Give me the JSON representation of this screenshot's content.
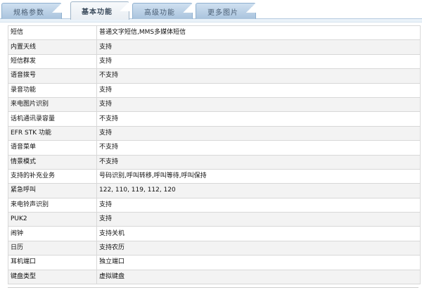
{
  "tabs": [
    {
      "label": "规格参数",
      "active": false
    },
    {
      "label": "基本功能",
      "active": true
    },
    {
      "label": "高级功能",
      "active": false
    },
    {
      "label": "更多图片",
      "active": false
    }
  ],
  "specs": [
    {
      "key": "短信",
      "value": "普通文字短信,MMS多媒体短信"
    },
    {
      "key": "内置天线",
      "value": "支持"
    },
    {
      "key": "短信群发",
      "value": "支持"
    },
    {
      "key": "语音拨号",
      "value": "不支持"
    },
    {
      "key": "录音功能",
      "value": "支持"
    },
    {
      "key": "来电图片识别",
      "value": "支持"
    },
    {
      "key": "话机通讯录容量",
      "value": "不支持"
    },
    {
      "key": "EFR STK 功能",
      "value": "支持"
    },
    {
      "key": "语音菜单",
      "value": "不支持"
    },
    {
      "key": "情景模式",
      "value": "不支持"
    },
    {
      "key": "支持的补充业务",
      "value": "号码识别,呼叫转移,呼叫等待,呼叫保持"
    },
    {
      "key": "紧急呼叫",
      "value": "122, 110, 119, 112, 120"
    },
    {
      "key": "来电铃声识别",
      "value": "支持"
    },
    {
      "key": "PUK2",
      "value": "支持"
    },
    {
      "key": "闹钟",
      "value": "支持关机"
    },
    {
      "key": "日历",
      "value": "支持农历"
    },
    {
      "key": "耳机端口",
      "value": "独立端口"
    },
    {
      "key": "键盘类型",
      "value": "虚拟键盘"
    }
  ]
}
